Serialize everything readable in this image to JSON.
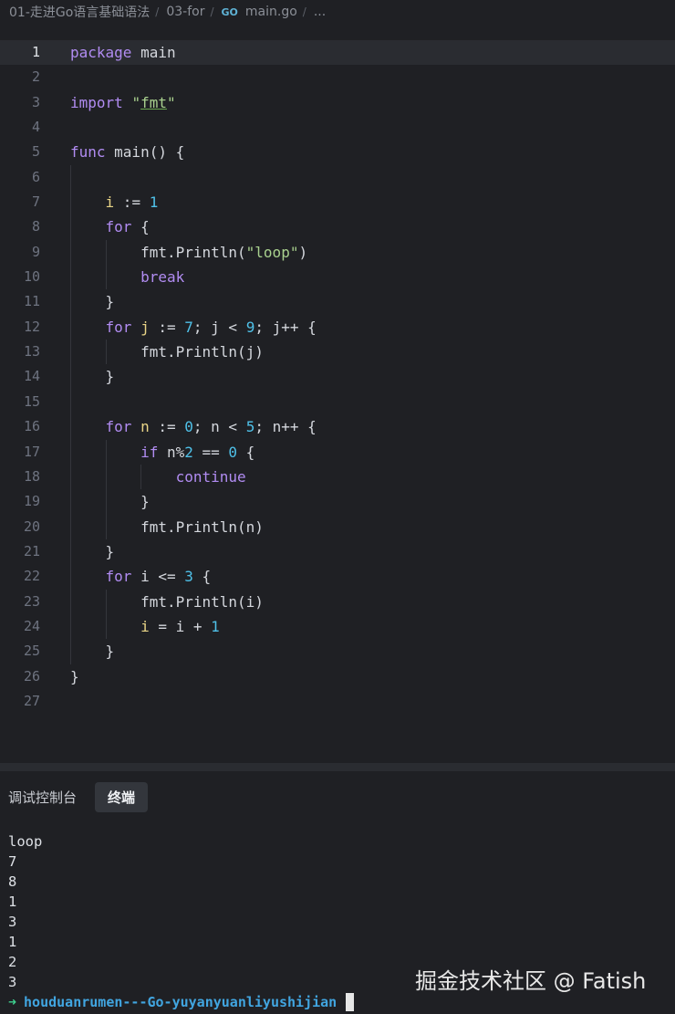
{
  "breadcrumb": {
    "folder1": "01-走进Go语言基础语法",
    "folder2": "03-for",
    "go_icon": "GO",
    "file": "main.go",
    "more": "..."
  },
  "code_lines": [
    {
      "n": "1",
      "t": "package main"
    },
    {
      "n": "2",
      "t": ""
    },
    {
      "n": "3",
      "t": "import \"fmt\""
    },
    {
      "n": "4",
      "t": ""
    },
    {
      "n": "5",
      "t": "func main() {"
    },
    {
      "n": "6",
      "t": ""
    },
    {
      "n": "7",
      "t": "    i := 1"
    },
    {
      "n": "8",
      "t": "    for {"
    },
    {
      "n": "9",
      "t": "        fmt.Println(\"loop\")"
    },
    {
      "n": "10",
      "t": "        break"
    },
    {
      "n": "11",
      "t": "    }"
    },
    {
      "n": "12",
      "t": "    for j := 7; j < 9; j++ {"
    },
    {
      "n": "13",
      "t": "        fmt.Println(j)"
    },
    {
      "n": "14",
      "t": "    }"
    },
    {
      "n": "15",
      "t": ""
    },
    {
      "n": "16",
      "t": "    for n := 0; n < 5; n++ {"
    },
    {
      "n": "17",
      "t": "        if n%2 == 0 {"
    },
    {
      "n": "18",
      "t": "            continue"
    },
    {
      "n": "19",
      "t": "        }"
    },
    {
      "n": "20",
      "t": "        fmt.Println(n)"
    },
    {
      "n": "21",
      "t": "    }"
    },
    {
      "n": "22",
      "t": "    for i <= 3 {"
    },
    {
      "n": "23",
      "t": "        fmt.Println(i)"
    },
    {
      "n": "24",
      "t": "        i = i + 1"
    },
    {
      "n": "25",
      "t": "    }"
    },
    {
      "n": "26",
      "t": "}"
    },
    {
      "n": "27",
      "t": ""
    }
  ],
  "panel": {
    "tab_debug": "调试控制台",
    "tab_terminal": "终端"
  },
  "terminal_output": [
    "loop",
    "7",
    "8",
    "1",
    "3",
    "1",
    "2",
    "3"
  ],
  "prompt": {
    "arrow": "➜",
    "dir": "houduanrumen---Go-yuyanyuanliyushijian"
  },
  "watermark": "掘金技术社区 @ Fatish",
  "colors": {
    "background": "#1f2024",
    "keyword": "#b18cf2",
    "string": "#a9d18e",
    "number": "#4fc1e9",
    "variable": "#e9d587",
    "prompt_arrow": "#3ecf8e",
    "prompt_dir": "#41a5e0"
  }
}
